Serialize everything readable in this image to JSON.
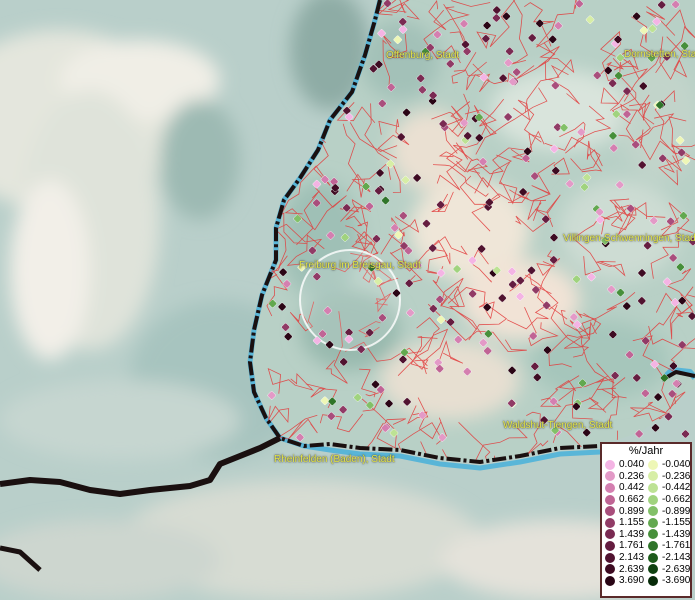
{
  "map": {
    "cities": [
      {
        "name": "Offenburg, Stadt"
      },
      {
        "name": "Dornstetten, Stadt"
      },
      {
        "name": "Freiburg im Breisgau, Stadt"
      },
      {
        "name": "Villingen-Schwenningen, Stadt"
      },
      {
        "name": "Waldshut-Tiengen, Stadt"
      },
      {
        "name": "Rheinfelden (Baden), Stadt"
      }
    ]
  },
  "legend": {
    "title": "%/Jahr",
    "positive": [
      {
        "label": "0.040",
        "color": "#f4b4e4"
      },
      {
        "label": "0.236",
        "color": "#e39ac7"
      },
      {
        "label": "0.442",
        "color": "#d47fb0"
      },
      {
        "label": "0.662",
        "color": "#c06495"
      },
      {
        "label": "0.899",
        "color": "#a94e7c"
      },
      {
        "label": "1.155",
        "color": "#913b66"
      },
      {
        "label": "1.439",
        "color": "#7a2a52"
      },
      {
        "label": "1.761",
        "color": "#651d40"
      },
      {
        "label": "2.143",
        "color": "#511330"
      },
      {
        "label": "2.639",
        "color": "#3e0b22"
      },
      {
        "label": "3.690",
        "color": "#2a0515"
      }
    ],
    "negative": [
      {
        "label": "-0.040",
        "color": "#eef7b6"
      },
      {
        "label": "-0.236",
        "color": "#d7eea6"
      },
      {
        "label": "-0.442",
        "color": "#bde294"
      },
      {
        "label": "-0.662",
        "color": "#a0d37e"
      },
      {
        "label": "-0.899",
        "color": "#82c068"
      },
      {
        "label": "-1.155",
        "color": "#62a84f"
      },
      {
        "label": "-1.439",
        "color": "#468f3a"
      },
      {
        "label": "-1.761",
        "color": "#2f7429"
      },
      {
        "label": "-2.143",
        "color": "#1d5b1b"
      },
      {
        "label": "-2.639",
        "color": "#0f4210"
      },
      {
        "label": "-3.690",
        "color": "#062a08"
      }
    ]
  }
}
